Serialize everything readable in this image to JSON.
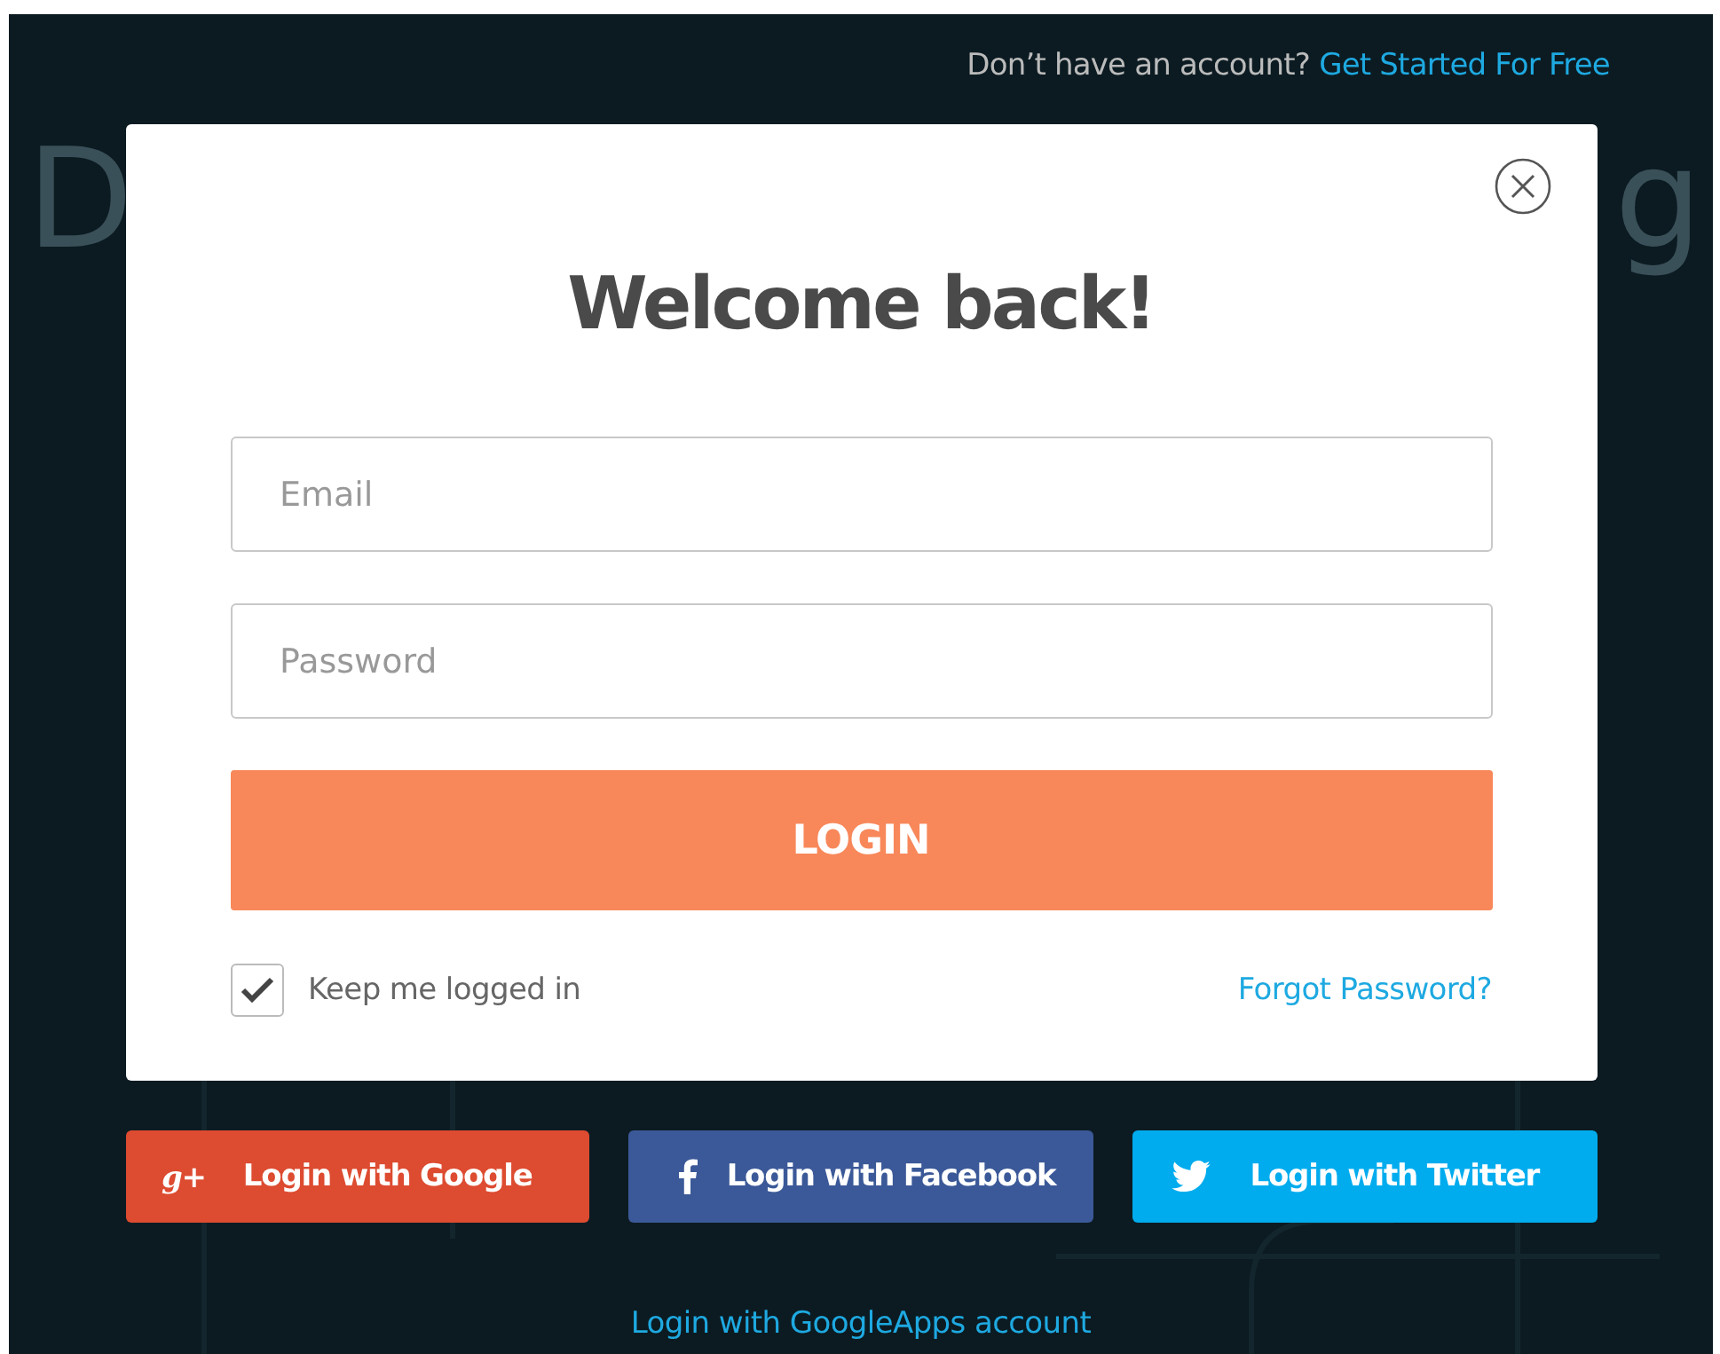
{
  "top_bar": {
    "prompt": "Don’t have an account?",
    "link": "Get Started For Free"
  },
  "backdrop_heading": {
    "left": "D",
    "right": "g"
  },
  "modal": {
    "title": "Welcome back!",
    "fields": [
      {
        "placeholder": "Email"
      },
      {
        "placeholder": "Password"
      }
    ],
    "submit": "LOGIN",
    "remember": {
      "label": "Keep me logged in",
      "checked": true
    },
    "forgot": "Forgot Password?"
  },
  "social_buttons": [
    {
      "label": "Login with Google",
      "kind": "google",
      "icon": "g+",
      "color": "#dd4b30"
    },
    {
      "label": "Login with Facebook",
      "kind": "facebook",
      "color": "#3b5998"
    },
    {
      "label": "Login with Twitter",
      "kind": "twitter",
      "color": "#00acee"
    }
  ],
  "footer_link": "Login with GoogleApps account"
}
